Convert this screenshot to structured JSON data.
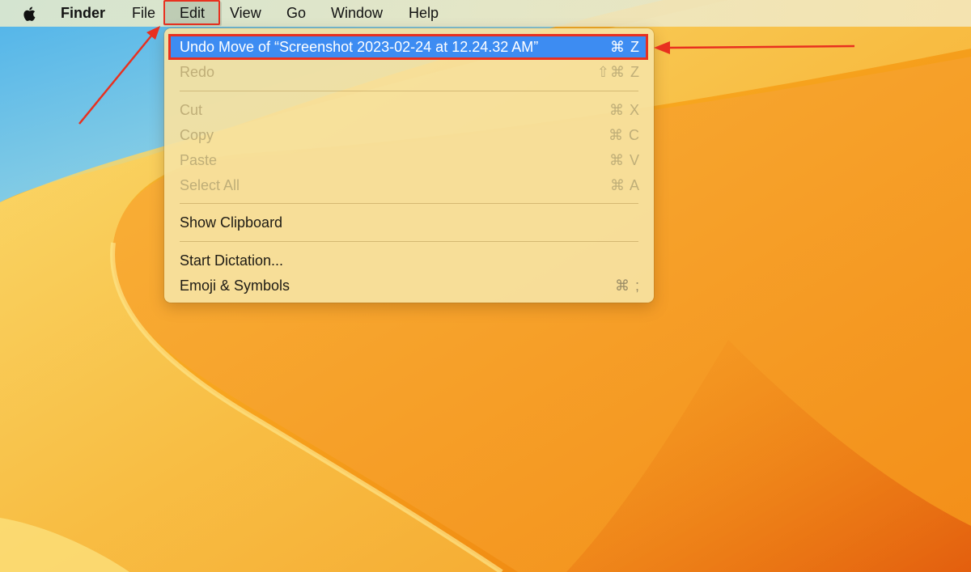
{
  "menubar": {
    "apple_icon": "apple-logo-icon",
    "app_name": "Finder",
    "items": [
      "File",
      "Edit",
      "View",
      "Go",
      "Window",
      "Help"
    ]
  },
  "edit_menu": {
    "undo": {
      "label": "Undo Move of “Screenshot 2023-02-24 at 12.24.32 AM”",
      "shortcut": "⌘ Z"
    },
    "redo": {
      "label": "Redo",
      "shortcut": "⇧⌘ Z"
    },
    "cut": {
      "label": "Cut",
      "shortcut": "⌘ X"
    },
    "copy": {
      "label": "Copy",
      "shortcut": "⌘ C"
    },
    "paste": {
      "label": "Paste",
      "shortcut": "⌘ V"
    },
    "select_all": {
      "label": "Select All",
      "shortcut": "⌘ A"
    },
    "show_clipboard": {
      "label": "Show Clipboard"
    },
    "start_dictation": {
      "label": "Start Dictation..."
    },
    "emoji_symbols": {
      "label": "Emoji & Symbols",
      "shortcut": "⌘ ;"
    }
  },
  "colors": {
    "highlight": "#3d8cf2",
    "annotation": "#e8301f"
  }
}
